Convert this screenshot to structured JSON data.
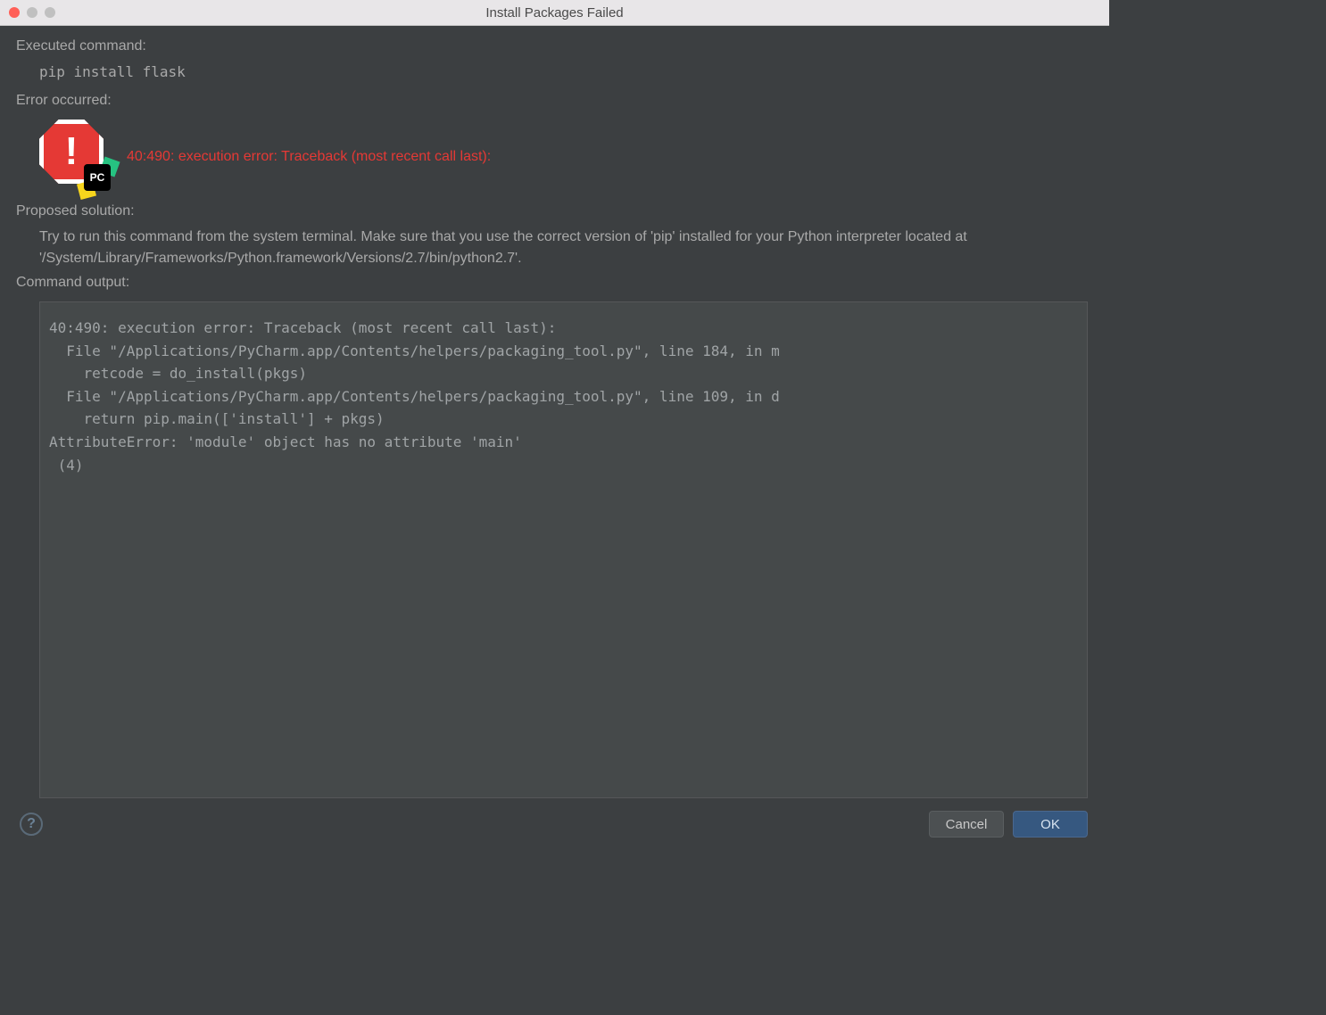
{
  "window": {
    "title": "Install Packages Failed"
  },
  "sections": {
    "executed_label": "Executed command:",
    "executed_command": "pip install flask",
    "error_label": "Error occurred:",
    "error_headline": "40:490: execution error: Traceback (most recent call last):",
    "badge_text": "PC",
    "proposed_label": "Proposed solution:",
    "proposed_text": "Try to run this command from the system terminal. Make sure that you use the correct version of 'pip' installed for your Python interpreter located at '/System/Library/Frameworks/Python.framework/Versions/2.7/bin/python2.7'.",
    "output_label": "Command output:",
    "output_text": "40:490: execution error: Traceback (most recent call last):\n  File \"/Applications/PyCharm.app/Contents/helpers/packaging_tool.py\", line 184, in m\n    retcode = do_install(pkgs)\n  File \"/Applications/PyCharm.app/Contents/helpers/packaging_tool.py\", line 109, in d\n    return pip.main(['install'] + pkgs)\nAttributeError: 'module' object has no attribute 'main'\n (4)"
  },
  "footer": {
    "help": "?",
    "cancel": "Cancel",
    "ok": "OK"
  }
}
